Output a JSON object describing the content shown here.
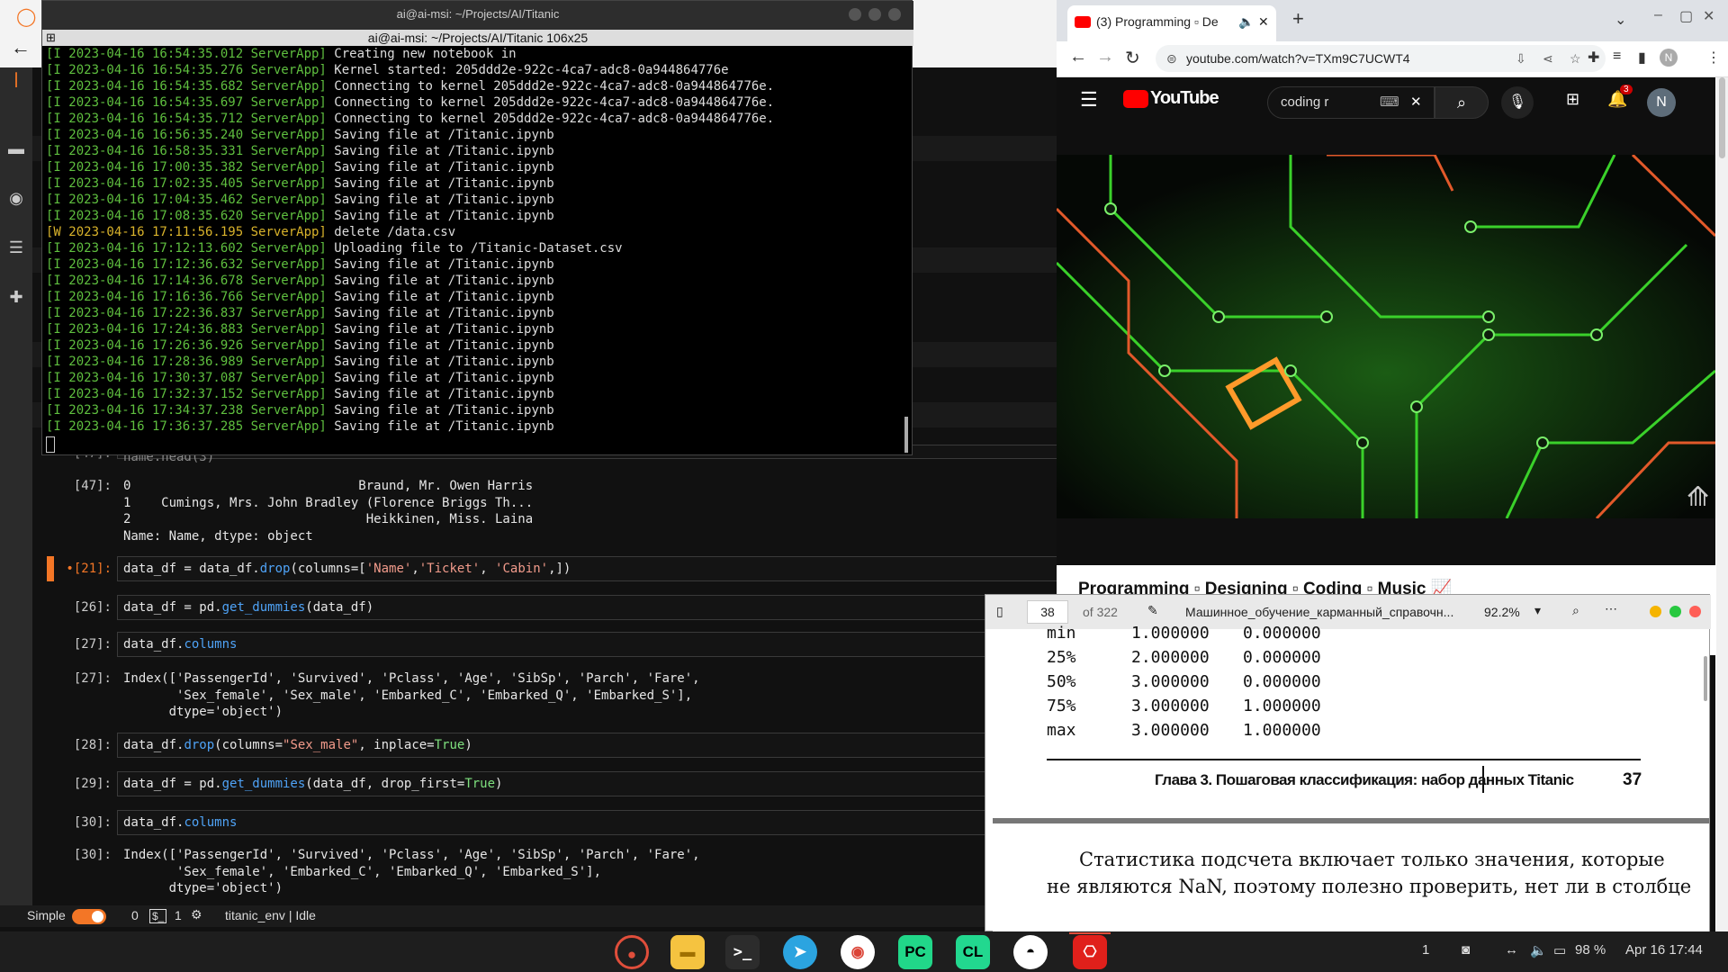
{
  "terminal": {
    "title": "ai@ai-msi: ~/Projects/AI/Titanic",
    "tab_title": "ai@ai-msi: ~/Projects/AI/Titanic 106x25",
    "lines": [
      {
        "level": "I",
        "ts": "2023-04-16 16:54:35.012",
        "src": "ServerApp",
        "msg": "Creating new notebook in"
      },
      {
        "level": "I",
        "ts": "2023-04-16 16:54:35.276",
        "src": "ServerApp",
        "msg": "Kernel started: 205ddd2e-922c-4ca7-adc8-0a944864776e"
      },
      {
        "level": "I",
        "ts": "2023-04-16 16:54:35.682",
        "src": "ServerApp",
        "msg": "Connecting to kernel 205ddd2e-922c-4ca7-adc8-0a944864776e."
      },
      {
        "level": "I",
        "ts": "2023-04-16 16:54:35.697",
        "src": "ServerApp",
        "msg": "Connecting to kernel 205ddd2e-922c-4ca7-adc8-0a944864776e."
      },
      {
        "level": "I",
        "ts": "2023-04-16 16:54:35.712",
        "src": "ServerApp",
        "msg": "Connecting to kernel 205ddd2e-922c-4ca7-adc8-0a944864776e."
      },
      {
        "level": "I",
        "ts": "2023-04-16 16:56:35.240",
        "src": "ServerApp",
        "msg": "Saving file at /Titanic.ipynb"
      },
      {
        "level": "I",
        "ts": "2023-04-16 16:58:35.331",
        "src": "ServerApp",
        "msg": "Saving file at /Titanic.ipynb"
      },
      {
        "level": "I",
        "ts": "2023-04-16 17:00:35.382",
        "src": "ServerApp",
        "msg": "Saving file at /Titanic.ipynb"
      },
      {
        "level": "I",
        "ts": "2023-04-16 17:02:35.405",
        "src": "ServerApp",
        "msg": "Saving file at /Titanic.ipynb"
      },
      {
        "level": "I",
        "ts": "2023-04-16 17:04:35.462",
        "src": "ServerApp",
        "msg": "Saving file at /Titanic.ipynb"
      },
      {
        "level": "I",
        "ts": "2023-04-16 17:08:35.620",
        "src": "ServerApp",
        "msg": "Saving file at /Titanic.ipynb"
      },
      {
        "level": "W",
        "ts": "2023-04-16 17:11:56.195",
        "src": "ServerApp",
        "msg": "delete /data.csv"
      },
      {
        "level": "I",
        "ts": "2023-04-16 17:12:13.602",
        "src": "ServerApp",
        "msg": "Uploading file to /Titanic-Dataset.csv"
      },
      {
        "level": "I",
        "ts": "2023-04-16 17:12:36.632",
        "src": "ServerApp",
        "msg": "Saving file at /Titanic.ipynb"
      },
      {
        "level": "I",
        "ts": "2023-04-16 17:14:36.678",
        "src": "ServerApp",
        "msg": "Saving file at /Titanic.ipynb"
      },
      {
        "level": "I",
        "ts": "2023-04-16 17:16:36.766",
        "src": "ServerApp",
        "msg": "Saving file at /Titanic.ipynb"
      },
      {
        "level": "I",
        "ts": "2023-04-16 17:22:36.837",
        "src": "ServerApp",
        "msg": "Saving file at /Titanic.ipynb"
      },
      {
        "level": "I",
        "ts": "2023-04-16 17:24:36.883",
        "src": "ServerApp",
        "msg": "Saving file at /Titanic.ipynb"
      },
      {
        "level": "I",
        "ts": "2023-04-16 17:26:36.926",
        "src": "ServerApp",
        "msg": "Saving file at /Titanic.ipynb"
      },
      {
        "level": "I",
        "ts": "2023-04-16 17:28:36.989",
        "src": "ServerApp",
        "msg": "Saving file at /Titanic.ipynb"
      },
      {
        "level": "I",
        "ts": "2023-04-16 17:30:37.087",
        "src": "ServerApp",
        "msg": "Saving file at /Titanic.ipynb"
      },
      {
        "level": "I",
        "ts": "2023-04-16 17:32:37.152",
        "src": "ServerApp",
        "msg": "Saving file at /Titanic.ipynb"
      },
      {
        "level": "I",
        "ts": "2023-04-16 17:34:37.238",
        "src": "ServerApp",
        "msg": "Saving file at /Titanic.ipynb"
      },
      {
        "level": "I",
        "ts": "2023-04-16 17:36:37.285",
        "src": "ServerApp",
        "msg": "Saving file at /Titanic.ipynb"
      }
    ]
  },
  "jupyter": {
    "partial_cell": "name.head(3)",
    "cells": [
      {
        "prompt": "[47]:",
        "type": "out",
        "text": "0                              Braund, Mr. Owen Harris\n1    Cumings, Mrs. John Bradley (Florence Briggs Th...\n2                               Heikkinen, Miss. Laina\nName: Name, dtype: object"
      },
      {
        "prompt": "•[21]:",
        "type": "in",
        "html": "data_df = data_df.<span class='kw'>drop</span>(columns=[<span class='str'>'Name'</span>,<span class='str'>'Ticket'</span>, <span class='str'>'Cabin'</span>,])"
      },
      {
        "prompt": "[26]:",
        "type": "in",
        "html": "data_df = pd.<span class='kw'>get_dummies</span>(data_df)"
      },
      {
        "prompt": "[27]:",
        "type": "in",
        "html": "data_df.<span class='kw'>columns</span>"
      },
      {
        "prompt": "[27]:",
        "type": "out",
        "text": "Index(['PassengerId', 'Survived', 'Pclass', 'Age', 'SibSp', 'Parch', 'Fare',\n       'Sex_female', 'Sex_male', 'Embarked_C', 'Embarked_Q', 'Embarked_S'],\n      dtype='object')"
      },
      {
        "prompt": "[28]:",
        "type": "in",
        "html": "data_df.<span class='kw'>drop</span>(columns=<span class='str'>\"Sex_male\"</span>, inplace=<span class='tru'>True</span>)"
      },
      {
        "prompt": "[29]:",
        "type": "in",
        "html": "data_df = pd.<span class='kw'>get_dummies</span>(data_df, drop_first=<span class='tru'>True</span>)"
      },
      {
        "prompt": "[30]:",
        "type": "in",
        "html": "data_df.<span class='kw'>columns</span>"
      },
      {
        "prompt": "[30]:",
        "type": "out",
        "text": "Index(['PassengerId', 'Survived', 'Pclass', 'Age', 'SibSp', 'Parch', 'Fare',\n       'Sex_female', 'Embarked_C', 'Embarked_Q', 'Embarked_S'],\n      dtype='object')"
      }
    ],
    "status": {
      "mode": "Simple",
      "count_a": "0",
      "count_b": "1",
      "kernel": "titanic_env | Idle"
    }
  },
  "chrome": {
    "tab_title": "(3) Programming ▫ De",
    "url": "youtube.com/watch?v=TXm9C7UCWT4",
    "profile_initial": "N",
    "youtube": {
      "logo": "YouTube",
      "search_value": "coding r",
      "notif_count": "3",
      "avatar": "N",
      "video_title": "Programming ▫ Designing ▫ Coding ▫ Music 📈"
    }
  },
  "pdf": {
    "page_current": "38",
    "page_total": "of 322",
    "filename": "Машинное_обучение_карманный_справочн...",
    "zoom": "92.2%",
    "table_rows": [
      {
        "label": "min",
        "c1": "1.000000",
        "c2": "0.000000"
      },
      {
        "label": "25%",
        "c1": "2.000000",
        "c2": "0.000000"
      },
      {
        "label": "50%",
        "c1": "3.000000",
        "c2": "0.000000"
      },
      {
        "label": "75%",
        "c1": "3.000000",
        "c2": "1.000000"
      },
      {
        "label": "max",
        "c1": "3.000000",
        "c2": "1.000000"
      }
    ],
    "chapter": "Глава 3. Пошаговая классификация: набор данных Titanic",
    "page_number": "37",
    "body_line1": "Статистика подсчета включает только значения, которые",
    "body_line2": "не являются NaN, поэтому полезно проверить, нет ли в столбце"
  },
  "taskbar": {
    "workspace": "1",
    "battery": "98 %",
    "datetime": "Apr 16  17:44"
  }
}
